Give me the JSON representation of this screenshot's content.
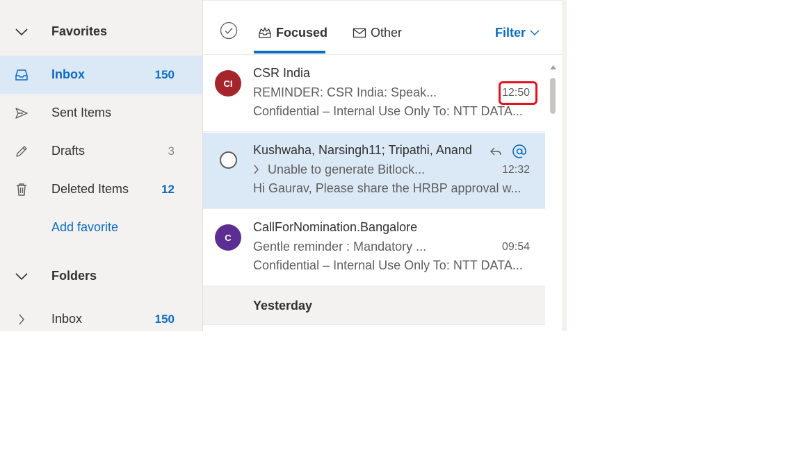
{
  "sidebar": {
    "favorites_header": "Favorites",
    "favorites": [
      {
        "label": "Inbox",
        "count": "150",
        "icon": "inbox-icon"
      },
      {
        "label": "Sent Items",
        "count": "",
        "icon": "send-icon"
      },
      {
        "label": "Drafts",
        "count": "3",
        "icon": "pencil-icon"
      },
      {
        "label": "Deleted Items",
        "count": "12",
        "icon": "trash-icon"
      }
    ],
    "add_favorite": "Add favorite",
    "folders_header": "Folders",
    "folders": [
      {
        "label": "Inbox",
        "count": "150"
      }
    ]
  },
  "tabs": {
    "focused": "Focused",
    "other": "Other",
    "filter": "Filter"
  },
  "messages": [
    {
      "initials": "CI",
      "avatar_color": "#a4262c",
      "sender": "CSR India",
      "subject": "REMINDER: CSR India: Speak...",
      "time": "12:50",
      "preview": "Confidential – Internal Use Only To: NTT DATA..."
    },
    {
      "initials": "",
      "sender": "Kushwaha, Narsingh11; Tripathi, Anand",
      "subject": "Unable to generate Bitlock...",
      "time": "12:32",
      "preview": "Hi Gaurav, Please share the HRBP approval w..."
    },
    {
      "initials": "C",
      "avatar_color": "#5c2e91",
      "sender": "CallForNomination.Bangalore",
      "subject": "Gentle reminder : Mandatory ...",
      "time": "09:54",
      "preview": "Confidential – Internal Use Only To: NTT DATA..."
    }
  ],
  "group_header": "Yesterday",
  "colors": {
    "accent": "#0f6cbd",
    "selection": "#dbe9f6",
    "highlight_box": "#e0141e"
  }
}
